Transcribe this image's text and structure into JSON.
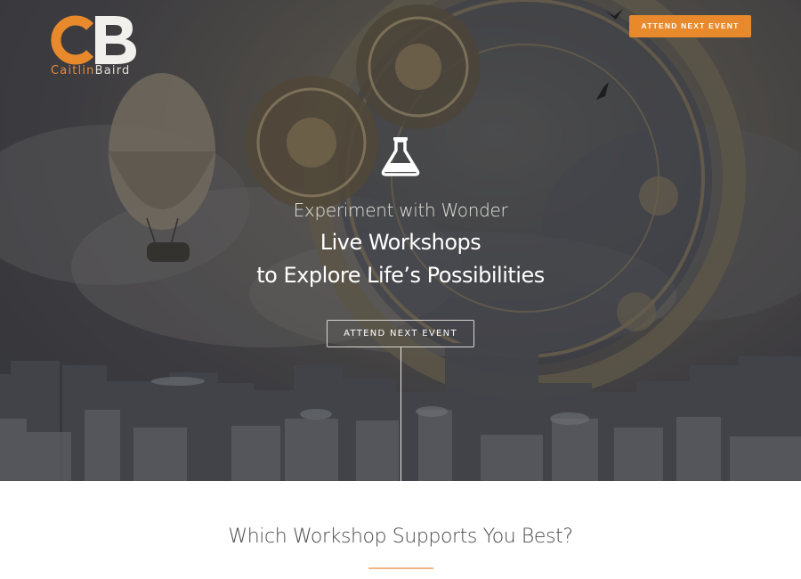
{
  "brand": {
    "logo_initials": "CB",
    "name_first": "Caitlin",
    "name_last": "Baird",
    "accent": "#e88a2c"
  },
  "header": {
    "cta_label": "ATTEND NEXT EVENT"
  },
  "hero": {
    "icon": "flask-icon",
    "tagline": "Experiment with Wonder",
    "headline_line1": "Live Workshops",
    "headline_line2": "to Explore Life’s Possibilities",
    "cta_label": "ATTEND NEXT EVENT"
  },
  "section": {
    "title": "Which Workshop Supports You Best?"
  }
}
